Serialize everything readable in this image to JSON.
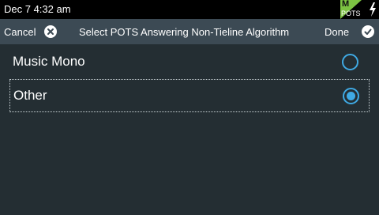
{
  "status_bar": {
    "time": "Dec 7 4:32 am",
    "badge_top": "M",
    "badge_bottom": "POTS",
    "power_icon": "lightning-bolt-icon"
  },
  "title_bar": {
    "cancel_label": "Cancel",
    "cancel_icon": "close-circle-icon",
    "title": "Select POTS Answering Non-Tieline Algorithm",
    "done_label": "Done",
    "done_icon": "check-circle-icon"
  },
  "options": [
    {
      "label": "Music Mono",
      "selected": false
    },
    {
      "label": "Other",
      "selected": true
    }
  ],
  "colors": {
    "background": "#242e33",
    "title_bar": "#3c4a54",
    "accent": "#3fa9e3",
    "badge_green": "#7cc242"
  }
}
